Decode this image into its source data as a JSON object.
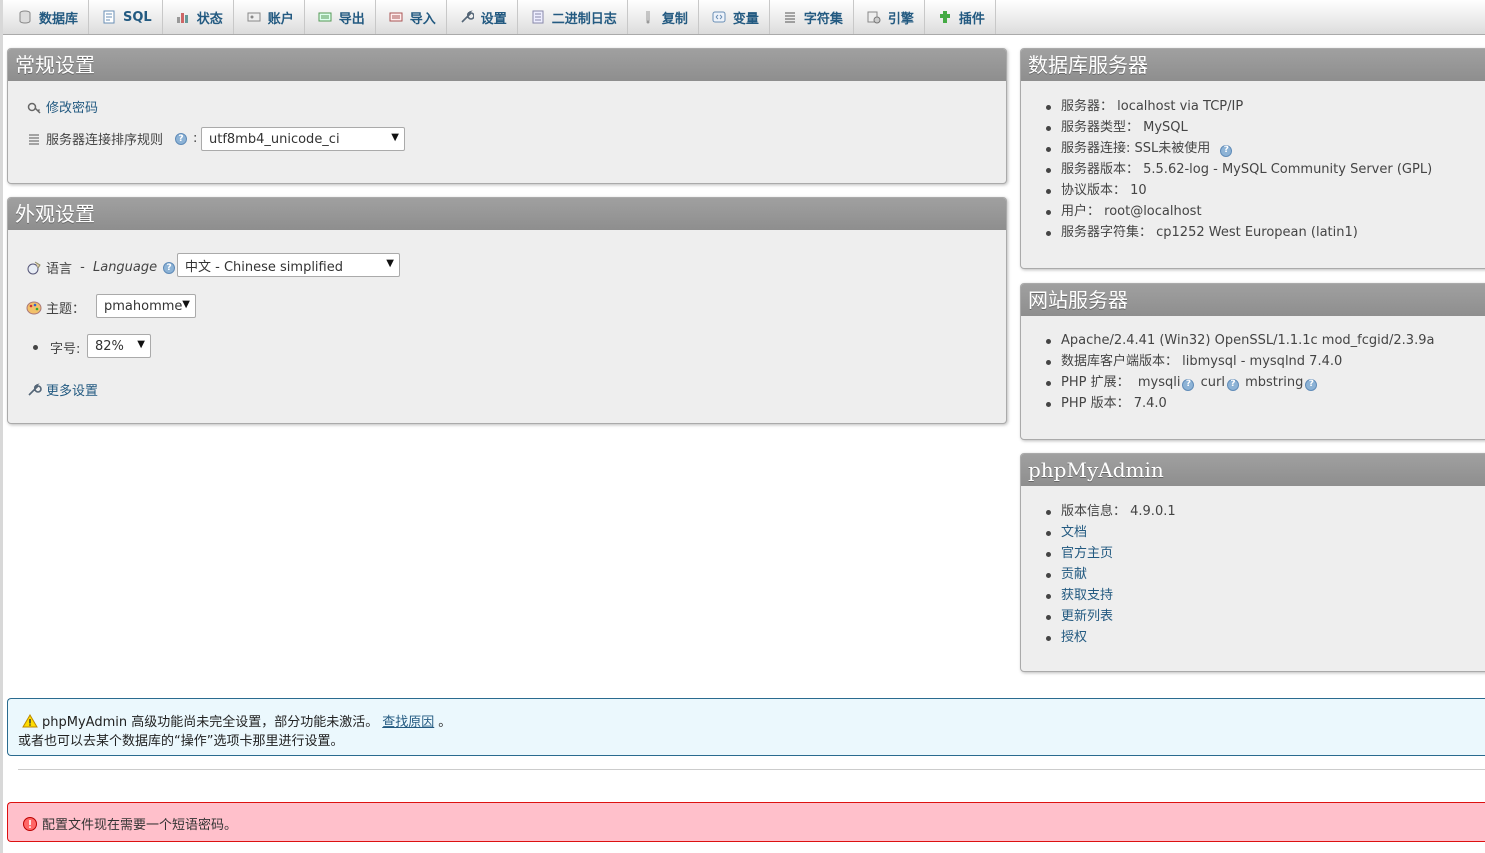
{
  "topmenu": [
    {
      "label": "数据库",
      "icon": "database-icon"
    },
    {
      "label": "SQL",
      "icon": "sql-icon"
    },
    {
      "label": "状态",
      "icon": "status-icon"
    },
    {
      "label": "账户",
      "icon": "users-icon"
    },
    {
      "label": "导出",
      "icon": "export-icon"
    },
    {
      "label": "导入",
      "icon": "import-icon"
    },
    {
      "label": "设置",
      "icon": "wrench-icon"
    },
    {
      "label": "二进制日志",
      "icon": "binlog-icon"
    },
    {
      "label": "复制",
      "icon": "replication-icon"
    },
    {
      "label": "变量",
      "icon": "variables-icon"
    },
    {
      "label": "字符集",
      "icon": "charset-icon"
    },
    {
      "label": "引擎",
      "icon": "engine-icon"
    },
    {
      "label": "插件",
      "icon": "plugin-icon"
    }
  ],
  "general": {
    "title": "常规设置",
    "change_password": "修改密码",
    "collation_label": "服务器连接排序规则",
    "collation_colon": ":",
    "collation_value": "utf8mb4_unicode_ci"
  },
  "appearance": {
    "title": "外观设置",
    "language_label": "语言",
    "language_sep": " - ",
    "language_en": "Language",
    "language_value": "中文 - Chinese simplified",
    "theme_label": "主题：",
    "theme_value": "pmahomme",
    "fontsize_label": "字号:",
    "fontsize_value": "82%",
    "more_settings": "更多设置"
  },
  "db_server": {
    "title": "数据库服务器",
    "items": [
      "服务器： localhost via TCP/IP",
      "服务器类型： MySQL",
      "服务器连接: SSL未被使用",
      "服务器版本： 5.5.62-log - MySQL Community Server (GPL)",
      "协议版本： 10",
      "用户： root@localhost",
      "服务器字符集： cp1252 West European (latin1)"
    ]
  },
  "web_server": {
    "title": "网站服务器",
    "items": [
      "Apache/2.4.41 (Win32) OpenSSL/1.1.1c mod_fcgid/2.3.9a",
      "数据库客户端版本： libmysql - mysqlnd 7.4.0",
      "PHP 版本： 7.4.0"
    ],
    "php_ext_label": "PHP 扩展： ",
    "php_ext": [
      "mysqli",
      "curl",
      "mbstring"
    ]
  },
  "pma": {
    "title": "phpMyAdmin",
    "version": "版本信息： 4.9.0.1",
    "links": [
      "文档",
      "官方主页",
      "贡献",
      "获取支持",
      "更新列表",
      "授权"
    ]
  },
  "notice": {
    "line1_prefix": "phpMyAdmin 高级功能尚未完全设置，部分功能未激活。",
    "line1_link": "查找原因",
    "line1_suffix": "。",
    "line2": "或者也可以去某个数据库的“操作”选项卡那里进行设置。"
  },
  "error": {
    "text": "配置文件现在需要一个短语密码。"
  },
  "help_glyph": "?",
  "colors": {
    "link": "#235a81",
    "panel_header": "#8e8e8e",
    "notice_bg": "#ebf8fd",
    "error_bg": "#ffc0cb"
  }
}
